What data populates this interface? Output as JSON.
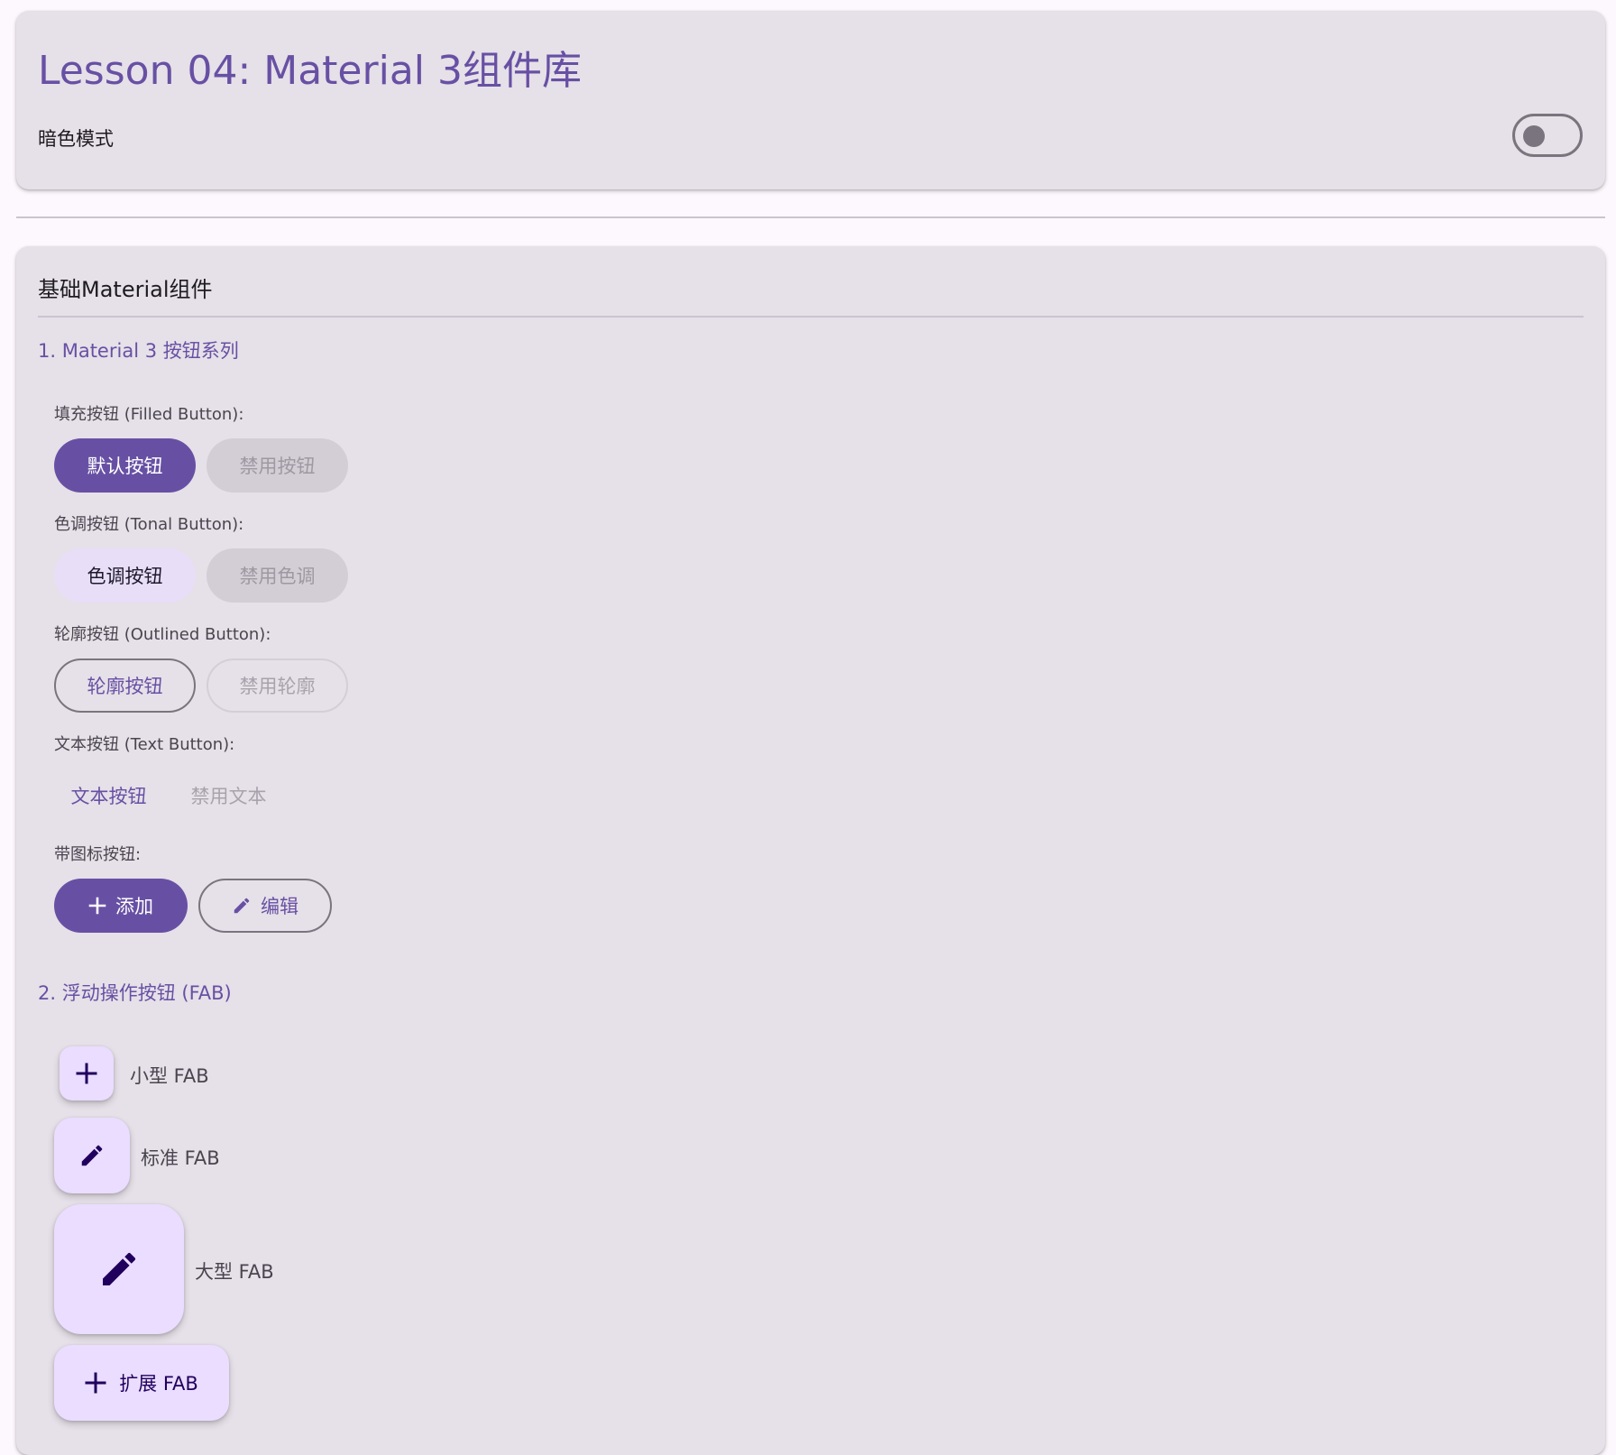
{
  "header": {
    "title": "Lesson 04: Material 3组件库",
    "dark_mode_label": "暗色模式",
    "dark_mode_on": false
  },
  "basic": {
    "title": "基础Material组件",
    "buttons_section": {
      "title": "1. Material 3 按钮系列",
      "filled": {
        "label": "填充按钮 (Filled Button):",
        "default": "默认按钮",
        "disabled": "禁用按钮"
      },
      "tonal": {
        "label": "色调按钮 (Tonal Button):",
        "default": "色调按钮",
        "disabled": "禁用色调"
      },
      "outlined": {
        "label": "轮廓按钮 (Outlined Button):",
        "default": "轮廓按钮",
        "disabled": "禁用轮廓"
      },
      "text": {
        "label": "文本按钮 (Text Button):",
        "default": "文本按钮",
        "disabled": "禁用文本"
      },
      "icon": {
        "label": "带图标按钮:",
        "add": "添加",
        "add_icon": "plus-icon",
        "edit": "编辑",
        "edit_icon": "pencil-icon"
      }
    },
    "fab_section": {
      "title": "2. 浮动操作按钮 (FAB)",
      "small": {
        "label": "小型 FAB",
        "icon": "plus-icon"
      },
      "standard": {
        "label": "标准 FAB",
        "icon": "pencil-icon"
      },
      "large": {
        "label": "大型 FAB",
        "icon": "pencil-icon"
      },
      "extended": {
        "label": "扩展 FAB",
        "icon": "plus-icon"
      }
    }
  },
  "colors": {
    "primary": "#6750a4",
    "surface_card": "#e6e0e8",
    "fab_container": "#eaddff",
    "tonal_container": "#e8def8"
  }
}
